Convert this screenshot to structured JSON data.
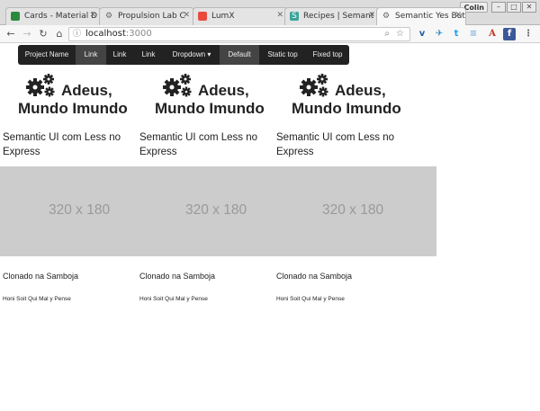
{
  "browser": {
    "tabs": [
      {
        "label": "Cards - Material D",
        "icon": "material-icon",
        "color": "#2b8a3e"
      },
      {
        "label": "Propulsion Lab C",
        "icon": "gear-icon",
        "color": "#666666"
      },
      {
        "label": "LumX",
        "icon": "lumx-icon",
        "color": "#e84b3c"
      },
      {
        "label": "Recipes | Semant",
        "icon": "semantic-s-icon",
        "color": "#3aa39a"
      },
      {
        "label": "Semantic Yes But",
        "icon": "gear-icon",
        "color": "#666666",
        "active": true
      }
    ],
    "user": "Colin",
    "window_controls": [
      "–",
      "□",
      "✕"
    ],
    "url_host": "localhost",
    "url_port": ":3000",
    "nav": {
      "back": "←",
      "forward": "→",
      "reload": "↻",
      "home": "⌂"
    },
    "extensions": [
      {
        "name": "vivaldi-icon",
        "glyph": "v",
        "color": "#1f5fa6"
      },
      {
        "name": "feedly-icon",
        "glyph": "✈",
        "color": "#2e86c1"
      },
      {
        "name": "twitter-icon",
        "glyph": "t",
        "color": "#1da1f2"
      },
      {
        "name": "buffer-icon",
        "glyph": "≡",
        "color": "#7fb3e0"
      },
      {
        "name": "text-icon",
        "glyph": "A",
        "color": "#c0392b"
      },
      {
        "name": "facebook-icon",
        "glyph": "f",
        "color": "#3b5998"
      },
      {
        "name": "menu-icon",
        "glyph": "⋮",
        "color": "#555555"
      }
    ]
  },
  "navbar": {
    "brand": "Project Name",
    "items": [
      "Link",
      "Link",
      "Link",
      "Dropdown ▾",
      "Default",
      "Static top",
      "Fixed top"
    ]
  },
  "cards": [
    {
      "title_line1": "Adeus,",
      "title_line2": "Mundo Imundo",
      "subtitle_line1": "Semantic UI com Less no",
      "subtitle_line2": "Express",
      "placeholder": "320 x 180",
      "clone_text": "Clonado na Samboja",
      "motto": "Honi Soit Qui Mal y Pense"
    },
    {
      "title_line1": "Adeus,",
      "title_line2": "Mundo Imundo",
      "subtitle_line1": "Semantic UI com Less no",
      "subtitle_line2": "Express",
      "placeholder": "320 x 180",
      "clone_text": "Clonado na Samboja",
      "motto": "Honi Soit Qui Mal y Pense"
    },
    {
      "title_line1": "Adeus,",
      "title_line2": "Mundo Imundo",
      "subtitle_line1": "Semantic UI com Less no",
      "subtitle_line2": "Express",
      "placeholder": "320 x 180",
      "clone_text": "Clonado na Samboja",
      "motto": "Honi Soit Qui Mal y Pense"
    }
  ],
  "colors": {
    "navbar": "#222222",
    "placeholder": "#cccccc"
  }
}
